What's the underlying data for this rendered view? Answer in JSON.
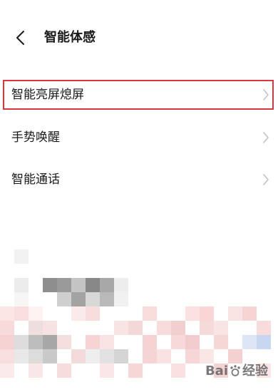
{
  "header": {
    "back_icon": "chevron-left-icon",
    "title": "智能体感"
  },
  "menu": {
    "items": [
      {
        "label": "智能亮屏熄屏",
        "icon": "chevron-right-icon",
        "highlighted": true
      },
      {
        "label": "手势唤醒",
        "icon": "chevron-right-icon",
        "highlighted": false
      },
      {
        "label": "智能通话",
        "icon": "chevron-right-icon",
        "highlighted": false
      }
    ]
  },
  "colors": {
    "highlight_border": "#d9363e",
    "chevron": "#c2c2c2",
    "text": "#1a1a1a"
  },
  "watermark": {
    "text_left": "Bai",
    "text_right": "经验"
  }
}
